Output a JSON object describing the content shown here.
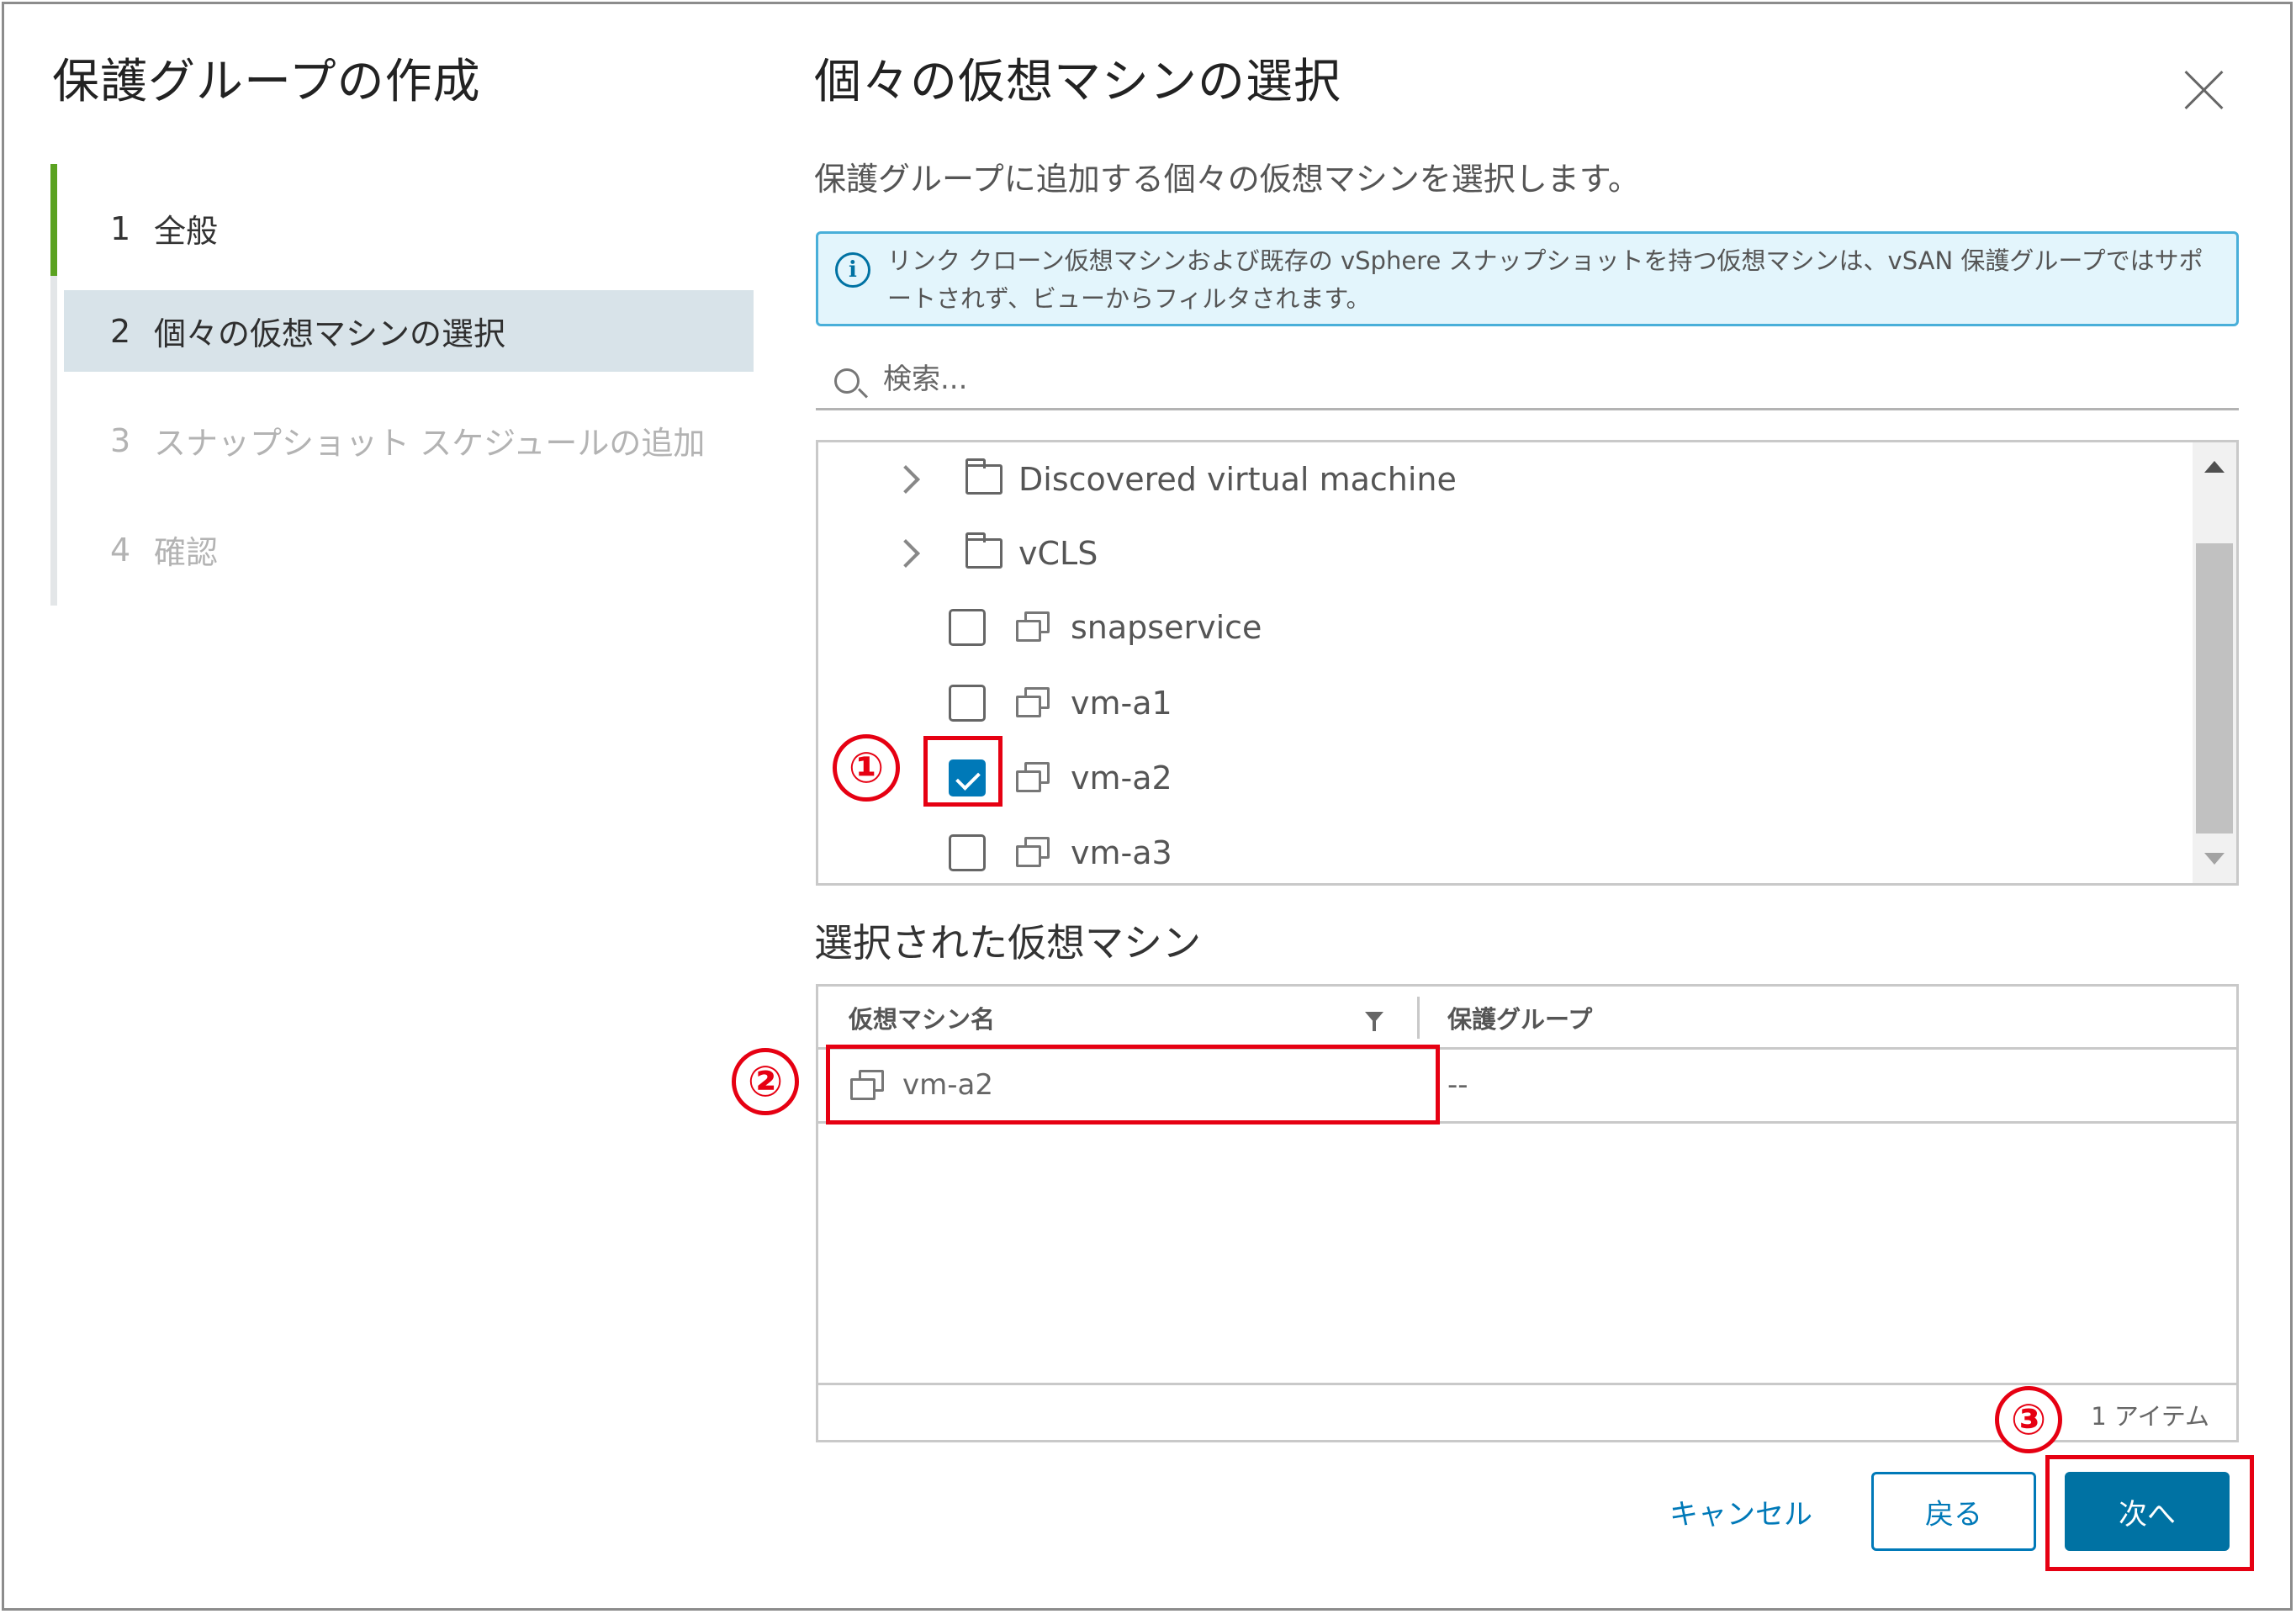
{
  "wizard": {
    "title": "保護グループの作成",
    "steps": [
      {
        "num": "1",
        "label": "全般"
      },
      {
        "num": "2",
        "label": "個々の仮想マシンの選択"
      },
      {
        "num": "3",
        "label": "スナップショット スケジュールの追加"
      },
      {
        "num": "4",
        "label": "確認"
      }
    ],
    "active_step": 2
  },
  "dialog": {
    "title": "個々の仮想マシンの選択",
    "description": "保護グループに追加する個々の仮想マシンを選択します。",
    "alert": "リンク クローン仮想マシンおよび既存の vSphere スナップショットを持つ仮想マシンは、vSAN 保護グループではサポートされず、ビューからフィルタされます。"
  },
  "search": {
    "placeholder": "検索..."
  },
  "tree": {
    "folders": [
      {
        "label": "Discovered virtual machine"
      },
      {
        "label": "vCLS"
      }
    ],
    "vms": [
      {
        "label": "snapservice",
        "checked": false
      },
      {
        "label": "vm-a1",
        "checked": false
      },
      {
        "label": "vm-a2",
        "checked": true
      },
      {
        "label": "vm-a3",
        "checked": false
      }
    ]
  },
  "selected": {
    "title": "選択された仮想マシン",
    "columns": [
      "仮想マシン名",
      "保護グループ"
    ],
    "rows": [
      {
        "name": "vm-a2",
        "group": "--"
      }
    ],
    "footer": "1 アイテム"
  },
  "buttons": {
    "cancel": "キャンセル",
    "back": "戻る",
    "next": "次へ"
  },
  "annotations": {
    "n1": "①",
    "n2": "②",
    "n3": "③",
    "color": "#e60012"
  },
  "colors": {
    "primary": "#0072a3",
    "active_step": "#5aa220",
    "alert_border": "#49afd9"
  }
}
